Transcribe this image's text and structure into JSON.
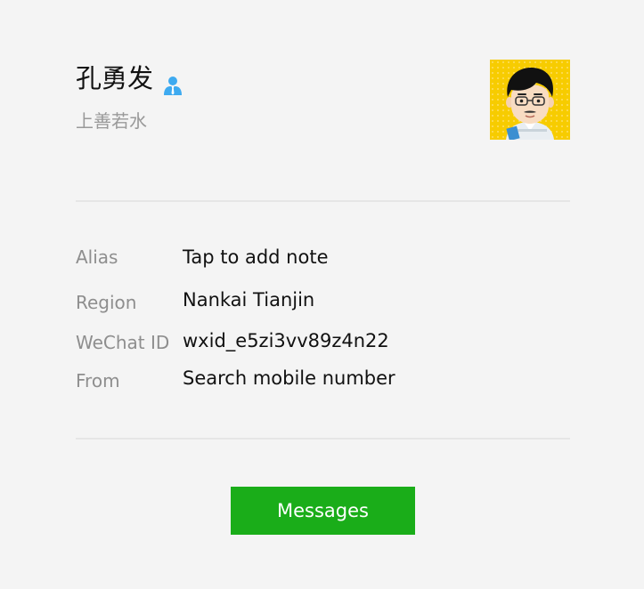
{
  "profile": {
    "name": "孔勇发",
    "gender_icon": "male-user-icon",
    "signature": "上善若水",
    "avatar_icon": "cartoon-avatar-icon"
  },
  "info": {
    "alias_label": "Alias",
    "alias_value": "Tap to add note",
    "region_label": "Region",
    "region_value": "Nankai Tianjin",
    "wechat_id_label": "WeChat ID",
    "wechat_id_value": "wxid_e5zi3vv89z4n22",
    "from_label": "From",
    "from_value": "Search mobile number"
  },
  "actions": {
    "messages_label": "Messages"
  },
  "colors": {
    "accent": "#1aad19",
    "gender_icon": "#3eaaf0",
    "avatar_bg": "#f7cc00",
    "background": "#f4f4f4"
  }
}
